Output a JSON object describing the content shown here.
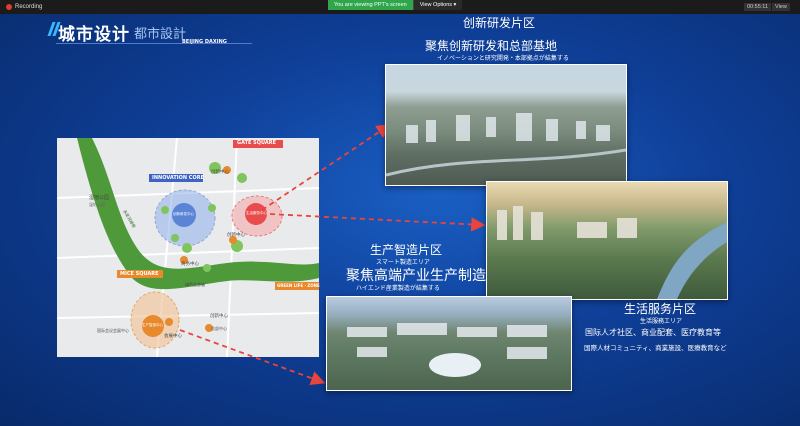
{
  "topbar": {
    "recording_label": "Recording",
    "share_message": "You are viewing PPT's screen",
    "view_options": "View Options ▾",
    "timer": "00:55:11",
    "view_button": "View"
  },
  "header": {
    "main_title": "城市设计",
    "sub_title": "都市設計",
    "tag": "BEIJING DAXING"
  },
  "map": {
    "labels": {
      "gate_square": "GATE SQUARE",
      "innovation_core": "INNOVATION CORE",
      "mice_square": "MICE SQUARE",
      "green_life_zone": "GREEN LIFE · ZONE",
      "park_1": "湿地公园",
      "park_1_jp": "湿地公園",
      "river": "永定河绿带",
      "green_corridor": "绿色生态轴",
      "node_1": "创新中心",
      "node_2": "创新中心",
      "node_3": "商务中心",
      "node_4": "会展中心",
      "node_5": "创新中心",
      "circle_blue": "创新研发中心",
      "circle_red": "生活服务中心",
      "circle_orange": "生产智造中心",
      "bottom_1": "国际会议会展中心",
      "bottom_2": "总部中心"
    },
    "colors": {
      "river": "#4e9a3a",
      "blue_zone": "#5b83d6",
      "red_zone": "#e84c4c",
      "orange_zone": "#e8892b",
      "arrow": "#e8453c"
    }
  },
  "zones": {
    "research": {
      "title": "创新研发片区",
      "heading": "聚焦创新研发和总部基地",
      "jp": "イノベーションと研究開発・本部拠点が結集する"
    },
    "manufacturing": {
      "title": "生产智造片区",
      "title_jp": "スマート製造エリア",
      "heading": "聚焦高端产业生产制造",
      "jp": "ハイエンド産業製造が結集する"
    },
    "service": {
      "title": "生活服务片区",
      "title_jp": "生活服務エリア",
      "heading": "国际人才社区、商业配套、医疗教育等",
      "jp": "国際人材コミュニティ、商業施設、医療教育など"
    }
  }
}
